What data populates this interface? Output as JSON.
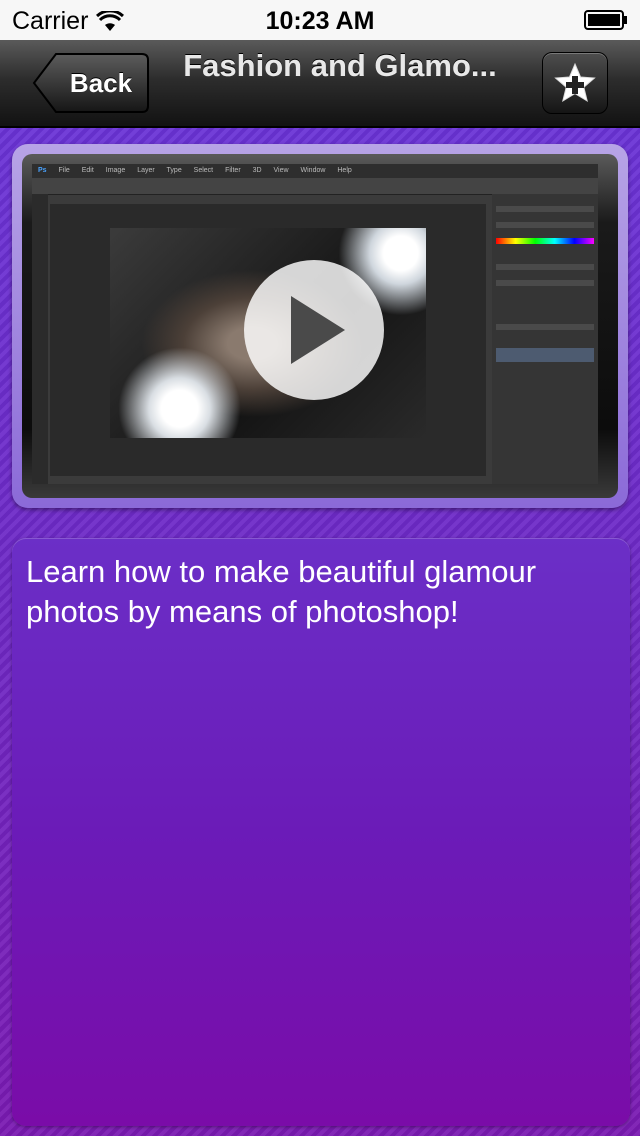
{
  "status_bar": {
    "carrier": "Carrier",
    "time": "10:23 AM",
    "wifi_icon": "wifi-icon",
    "battery_icon": "battery-icon"
  },
  "nav": {
    "back_label": "Back",
    "title": "Fashion and Glamo...",
    "favorite_icon": "star-plus-icon"
  },
  "video": {
    "play_icon": "play-icon",
    "ps_menu": [
      "File",
      "Edit",
      "Image",
      "Layer",
      "Type",
      "Select",
      "Filter",
      "3D",
      "View",
      "Window",
      "Help"
    ]
  },
  "description": "Learn how to make beautiful glamour photos by means of photoshop!",
  "colors": {
    "background": "#6a2fc9",
    "nav_bar": "#2d2d2d",
    "text": "#ffffff"
  }
}
